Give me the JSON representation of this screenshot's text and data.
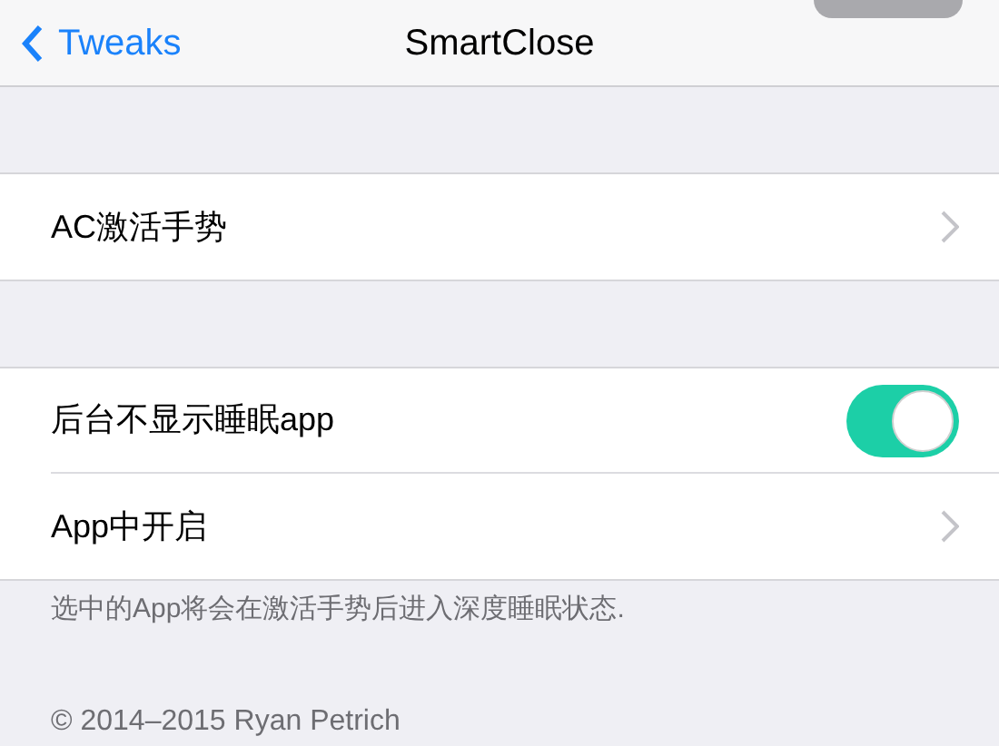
{
  "nav": {
    "back_label": "Tweaks",
    "title": "SmartClose"
  },
  "sections": [
    {
      "rows": [
        {
          "kind": "link",
          "label": "AC激活手势"
        }
      ]
    },
    {
      "rows": [
        {
          "kind": "toggle",
          "label": "后台不显示睡眠app",
          "on": true
        },
        {
          "kind": "link",
          "label": "App中开启"
        }
      ],
      "footer": "选中的App将会在激活手势后进入深度睡眠状态."
    }
  ],
  "copyright": "© 2014–2015 Ryan Petrich"
}
